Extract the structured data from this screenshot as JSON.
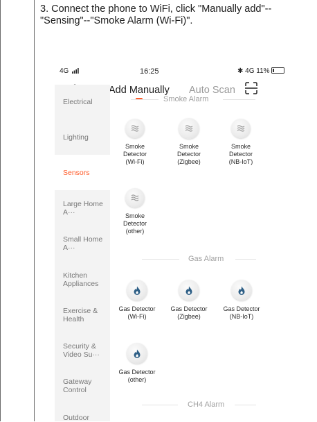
{
  "instruction": "3. Connect the phone to WiFi, click \"Manually add\"--\"Sensing\"--\"Smoke Alarm (Wi-Fi)\".",
  "status_bar": {
    "network": "4G",
    "time": "16:25",
    "right": "✱ 4G 11%"
  },
  "header": {
    "back": "<",
    "tab_active": "Add Manually",
    "tab_inactive": "Auto Scan"
  },
  "sidebar": {
    "items": [
      {
        "label": "Electrical"
      },
      {
        "label": "Lighting"
      },
      {
        "label": "Sensors"
      },
      {
        "label": "Large Home A···"
      },
      {
        "label": "Small Home A···"
      },
      {
        "label": "Kitchen Appliances"
      },
      {
        "label": "Exercise & Health"
      },
      {
        "label": "Security & Video Su···"
      },
      {
        "label": "Gateway Control"
      },
      {
        "label": "Outdoor"
      }
    ],
    "active_index": 2
  },
  "sections": [
    {
      "title": "Smoke Alarm",
      "devices": [
        {
          "line1": "Smoke",
          "line2": "Detector",
          "line3": "(Wi-Fi)"
        },
        {
          "line1": "Smoke",
          "line2": "Detector",
          "line3": "(Zigbee)"
        },
        {
          "line1": "Smoke",
          "line2": "Detector",
          "line3": "(NB-IoT)"
        },
        {
          "line1": "Smoke",
          "line2": "Detector",
          "line3": "(other)"
        }
      ]
    },
    {
      "title": "Gas Alarm",
      "devices": [
        {
          "line1": "Gas Detector",
          "line2": "(Wi-Fi)"
        },
        {
          "line1": "Gas Detector",
          "line2": "(Zigbee)"
        },
        {
          "line1": "Gas Detector",
          "line2": "(NB-IoT)"
        },
        {
          "line1": "Gas Detector",
          "line2": "(other)"
        }
      ]
    },
    {
      "title": "CH4 Alarm",
      "devices": []
    }
  ],
  "colors": {
    "accent": "#ff5a28",
    "flame": "#2e5f86",
    "sidebar_bg": "#f3f3f3"
  }
}
